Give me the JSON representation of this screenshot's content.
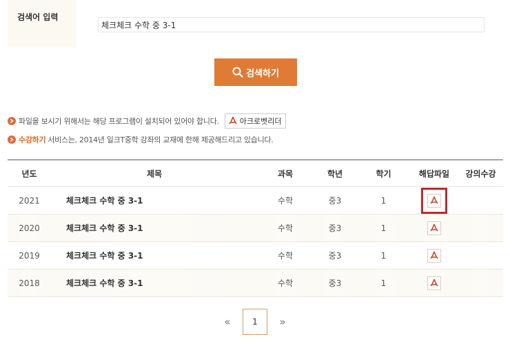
{
  "search": {
    "label": "검색어 입력",
    "value": "체크체크 수학 중 3-1",
    "button_label": "검색하기"
  },
  "notices": [
    {
      "highlight": "",
      "text": "파일을 보시기 위해서는 해당 프로그램이 설치되어 있어야 합니다.",
      "button": "아크로벳리더"
    },
    {
      "highlight": "수강하기",
      "text": "서비스는, 2014년 일크T중학 강좌의 교재에 한해 제공해드리고 있습니다."
    }
  ],
  "table": {
    "headers": [
      "년도",
      "제목",
      "과목",
      "학년",
      "학기",
      "해답파일",
      "강의수강"
    ],
    "rows": [
      {
        "year": "2021",
        "title": "체크체크 수학 중 3-1",
        "subject": "수학",
        "grade": "중3",
        "semester": "1",
        "file_icon": "pdf-icon",
        "lecture": ""
      },
      {
        "year": "2020",
        "title": "체크체크 수학 중 3-1",
        "subject": "수학",
        "grade": "중3",
        "semester": "1",
        "file_icon": "pdf-icon",
        "lecture": ""
      },
      {
        "year": "2019",
        "title": "체크체크 수학 중 3-1",
        "subject": "수학",
        "grade": "중3",
        "semester": "1",
        "file_icon": "pdf-icon",
        "lecture": ""
      },
      {
        "year": "2018",
        "title": "체크체크 수학 중 3-1",
        "subject": "수학",
        "grade": "중3",
        "semester": "1",
        "file_icon": "pdf-icon",
        "lecture": ""
      }
    ]
  },
  "pagination": {
    "prev": "«",
    "current": "1",
    "next": "»"
  },
  "colors": {
    "accent": "#e07b36",
    "highlight": "#c1272d",
    "notice_dot": "#e06a3a"
  }
}
